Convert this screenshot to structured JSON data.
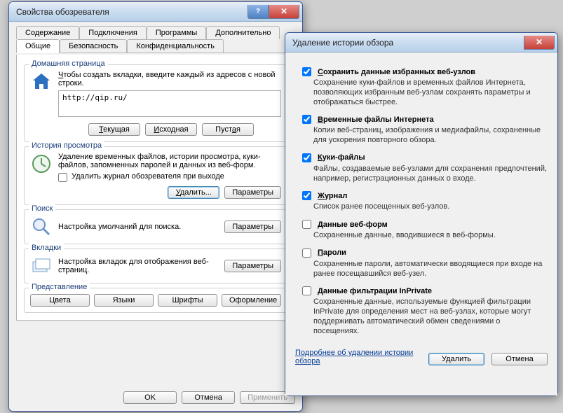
{
  "win1": {
    "title": "Свойства обозревателя",
    "helpGlyph": "?",
    "closeGlyph": "✕",
    "tabs": {
      "row1": [
        "Содержание",
        "Подключения",
        "Программы",
        "Дополнительно"
      ],
      "row2": [
        "Общие",
        "Безопасность",
        "Конфиденциальность"
      ],
      "active": "Общие"
    },
    "home": {
      "legend": "Домашняя страница",
      "hint_pre": "Ч",
      "hint_rest": "тобы создать вкладки, введите каждый из адресов с новой строки.",
      "url": "http://qip.ru/",
      "btn_current_u": "Т",
      "btn_current_rest": "екущая",
      "btn_initial_u": "И",
      "btn_initial_rest": "сходная",
      "btn_blank": "Пуст",
      "btn_blank_u": "а",
      "btn_blank_rest": "я"
    },
    "history": {
      "legend": "История просмотра",
      "desc": "Удаление временных файлов, истории просмотра, куки-файлов, запомненных паролей и данных из веб-форм.",
      "chk_label": "Удалить журнал обозревателя при выходе",
      "btn_delete_u": "У",
      "btn_delete_rest": "далить...",
      "btn_params": "Параметры"
    },
    "search": {
      "legend": "Поиск",
      "desc": "Настройка умолчаний для поиска.",
      "btn_params": "Параметры"
    },
    "tabsGroup": {
      "legend": "Вкладки",
      "desc": "Настройка вкладок для отображения веб-страниц.",
      "btn_params": "Параметры"
    },
    "appearance": {
      "legend": "Представление",
      "btn_colors": "Цвета",
      "btn_langs": "Языки",
      "btn_fonts": "Шрифты",
      "btn_format": "Оформление"
    },
    "footer": {
      "ok": "OK",
      "cancel": "Отмена",
      "apply": "Применить"
    }
  },
  "win2": {
    "title": "Удаление истории обзора",
    "closeGlyph": "✕",
    "items": [
      {
        "checked": true,
        "title": "Сохранить данные избранных веб-узлов",
        "desc": "Сохранение куки-файлов и временных файлов Интернета, позволяющих избранным веб-узлам сохранять параметры и отображаться быстрее."
      },
      {
        "checked": true,
        "title": "Временные файлы Интернета",
        "desc": "Копии веб-страниц, изображения и медиафайлы, сохраненные для ускорения повторного обзора."
      },
      {
        "checked": true,
        "title": "Куки-файлы",
        "desc": "Файлы, создаваемые веб-узлами для сохранения предпочтений, например, регистрационных данных о входе."
      },
      {
        "checked": true,
        "title": "Журнал",
        "desc": "Список ранее посещенных веб-узлов."
      },
      {
        "checked": false,
        "title": "Данные веб-форм",
        "desc": "Сохраненные данные, вводившиеся в веб-формы."
      },
      {
        "checked": false,
        "title": "Пароли",
        "desc": "Сохраненные пароли, автоматически вводящиеся при входе на ранее посещавшийся веб-узел."
      },
      {
        "checked": false,
        "title": "Данные фильтрации InPrivate",
        "desc": "Сохраненные данные, используемые функцией фильтрации InPrivate для определения мест на веб-узлах, которые могут поддерживать автоматический обмен сведениями о посещениях."
      }
    ],
    "learn_more": "Подробнее об удалении истории обзора",
    "btn_delete": "Удалить",
    "btn_cancel": "Отмена"
  }
}
